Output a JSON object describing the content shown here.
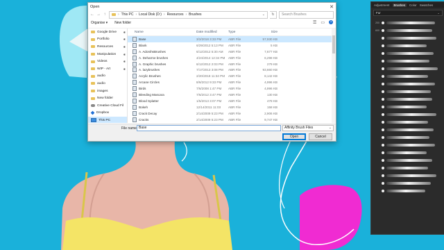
{
  "dialog": {
    "title": "Open",
    "close_glyph": "✕",
    "address": {
      "back_glyph": "←",
      "forward_glyph": "→",
      "up_glyph": "↑",
      "crumbs": [
        "This PC",
        "Local Disk (D:)",
        "Resources",
        "Brushes"
      ],
      "separator": "›",
      "dropdown_glyph": "⌄",
      "refresh_glyph": "↻",
      "search_placeholder": "Search Brushes"
    },
    "toolbar": {
      "organise": "Organise ▾",
      "new_folder": "New folder",
      "view_glyph": "☰",
      "pane_glyph": "▭",
      "help_glyph": "?"
    },
    "nav": [
      {
        "label": "Google Drive",
        "icon": "folder-icon",
        "pinned": true,
        "selected": false
      },
      {
        "label": "Portfolio",
        "icon": "folder-icon",
        "pinned": true,
        "selected": false
      },
      {
        "label": "Resources",
        "icon": "folder-icon",
        "pinned": true,
        "selected": false
      },
      {
        "label": "Manipulation",
        "icon": "folder-icon",
        "pinned": true,
        "selected": false
      },
      {
        "label": "Videos",
        "icon": "folder-icon",
        "pinned": true,
        "selected": false
      },
      {
        "label": "WIP - Art",
        "icon": "folder-icon",
        "pinned": true,
        "selected": false
      },
      {
        "label": "audio",
        "icon": "folder-icon",
        "pinned": false,
        "selected": false
      },
      {
        "label": "audio",
        "icon": "folder-icon",
        "pinned": false,
        "selected": false
      },
      {
        "label": "images",
        "icon": "folder-icon",
        "pinned": false,
        "selected": false
      },
      {
        "label": "New folder",
        "icon": "folder-icon",
        "pinned": false,
        "selected": false
      },
      {
        "label": "Creative Cloud Fil",
        "icon": "cloud-icon",
        "pinned": false,
        "selected": false
      },
      {
        "label": "Dropbox",
        "icon": "dropbox-icon",
        "pinned": false,
        "selected": false
      },
      {
        "label": "This PC",
        "icon": "pc-icon",
        "pinned": false,
        "selected": true
      },
      {
        "label": "Network",
        "icon": "network-icon",
        "pinned": false,
        "selected": false
      }
    ],
    "pin_glyph": "✱",
    "columns": {
      "name": "Name",
      "date": "Date modified",
      "type": "Type",
      "size": "Size"
    },
    "files": [
      {
        "name": "Base",
        "date": "3/2/2018 3:33 PM",
        "type": "ABR File",
        "size": "57,930 KB",
        "selected": true
      },
      {
        "name": "Blank",
        "date": "6/29/2012 5:13 PM",
        "type": "ABR File",
        "size": "5 KB",
        "selected": false
      },
      {
        "name": "A. AdonihsBrushes",
        "date": "6/12/2012 5:30 AM",
        "type": "ABR File",
        "size": "7,677 KB",
        "selected": false
      },
      {
        "name": "A. Deharme brushes",
        "date": "4/24/2014 12:34 PM",
        "type": "ABR File",
        "size": "6,298 KB",
        "selected": false
      },
      {
        "name": "A. Graphic brushes",
        "date": "6/12/2012 2:03 PM",
        "type": "ABR File",
        "size": "279 KB",
        "selected": false
      },
      {
        "name": "A. lazybrushes",
        "date": "7/17/2013 3:08 PM",
        "type": "ABR File",
        "size": "93,660 KB",
        "selected": false
      },
      {
        "name": "Acrylic Brushes",
        "date": "2/20/2018 11:34 PM",
        "type": "ABR File",
        "size": "8,142 KB",
        "selected": false
      },
      {
        "name": "Arcane Circles",
        "date": "8/6/2012 9:33 PM",
        "type": "ABR File",
        "size": "4,996 KB",
        "selected": false
      },
      {
        "name": "Birds",
        "date": "7/6/2008 1:47 PM",
        "type": "ABR File",
        "size": "4,996 KB",
        "selected": false
      },
      {
        "name": "Bleeding Mascara",
        "date": "7/6/2012 3:47 PM",
        "type": "ABR File",
        "size": "130 KB",
        "selected": false
      },
      {
        "name": "Blood Splatter",
        "date": "1/5/2013 3:07 PM",
        "type": "ABR File",
        "size": "478 KB",
        "selected": false
      },
      {
        "name": "Bokeh",
        "date": "12/14/2011 11:03",
        "type": "ABR File",
        "size": "158 KB",
        "selected": false
      },
      {
        "name": "Crack Decay",
        "date": "2/14/2009 5:23 PM",
        "type": "ABR File",
        "size": "2,906 KB",
        "selected": false
      },
      {
        "name": "Cracks",
        "date": "2/14/2009 5:23 PM",
        "type": "ABR File",
        "size": "9,747 KB",
        "selected": false
      },
      {
        "name": "Crowd",
        "date": "2/8/2007 4:23 PM",
        "type": "ABR File",
        "size": "2,975 KB",
        "selected": false
      },
      {
        "name": "Debris Brush",
        "date": "1/9/2013 8:09 PM",
        "type": "ABR File",
        "size": "296 KB",
        "selected": false
      },
      {
        "name": "dirt-brushes",
        "date": "3/3/2011 12:15 PM",
        "type": "ABR File",
        "size": "8,162 KB",
        "selected": false
      }
    ],
    "bottom": {
      "filename_label": "File name:",
      "filename_value": "Base",
      "filetype_value": "Affinity Brush Files",
      "chevron_glyph": "⌄",
      "open_label": "Open",
      "cancel_label": "Cancel"
    }
  },
  "panel": {
    "tabs": [
      "Adjustment",
      "Brushes",
      "Color",
      "Swatches"
    ],
    "active_tab": "Brushes",
    "category": "Fur",
    "chevron_glyph": "⌄",
    "brushes": [
      "200",
      "600",
      "",
      "",
      "",
      "",
      "",
      "",
      "",
      "",
      "",
      "",
      "",
      "",
      "",
      "",
      "",
      "",
      "",
      "",
      "",
      "",
      ""
    ]
  }
}
